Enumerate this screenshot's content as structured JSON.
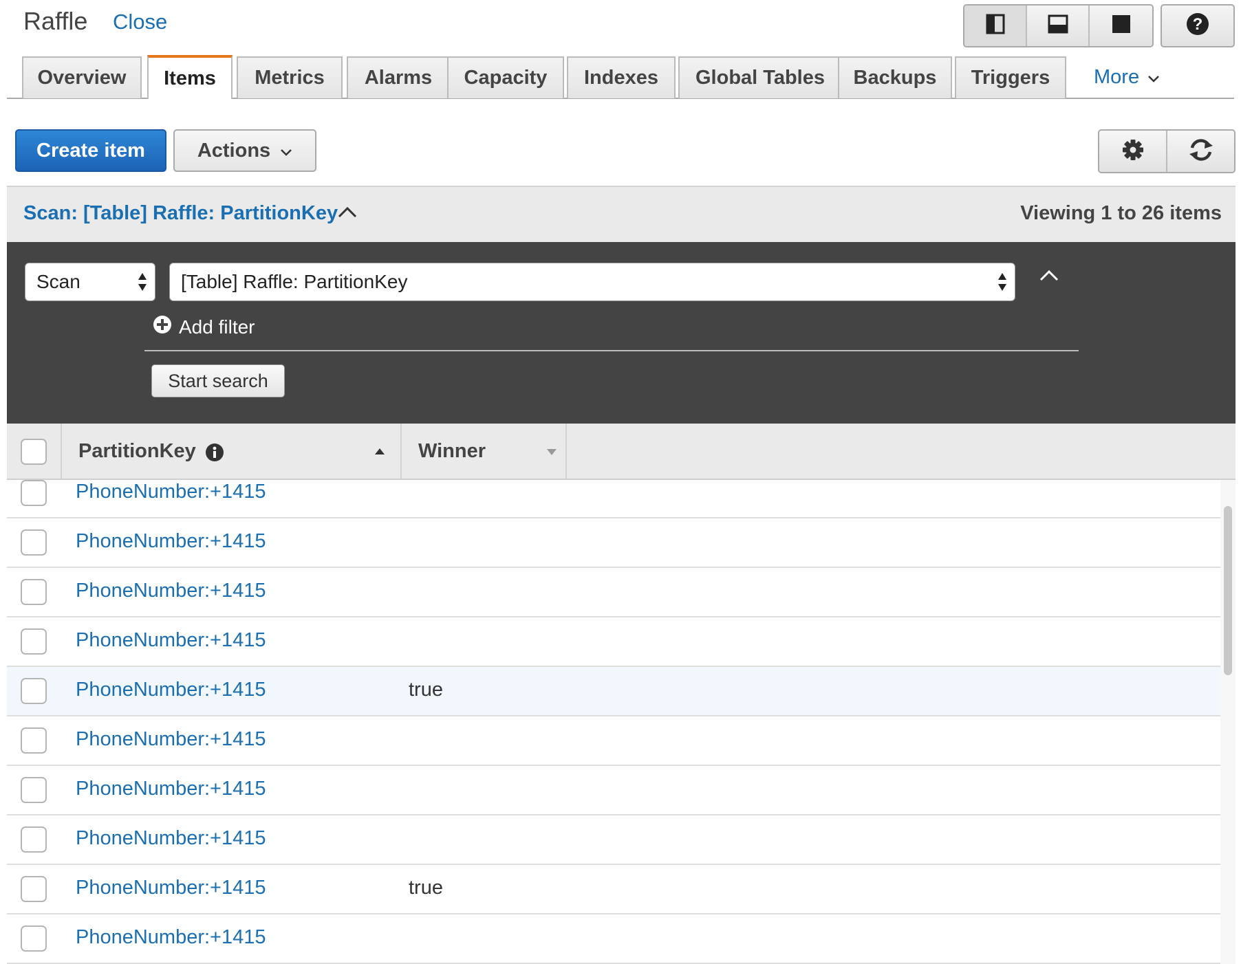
{
  "header": {
    "title": "Raffle",
    "close_label": "Close",
    "view_buttons": [
      "split-vertical-icon",
      "split-horizontal-icon",
      "fullscreen-icon"
    ],
    "help_icon": "help-icon"
  },
  "tabs": [
    {
      "label": "Overview",
      "active": false
    },
    {
      "label": "Items",
      "active": true
    },
    {
      "label": "Metrics",
      "active": false
    },
    {
      "label": "Alarms",
      "active": false
    },
    {
      "label": "Capacity",
      "active": false
    },
    {
      "label": "Indexes",
      "active": false
    },
    {
      "label": "Global Tables",
      "active": false
    },
    {
      "label": "Backups",
      "active": false
    },
    {
      "label": "Triggers",
      "active": false
    }
  ],
  "more_label": "More",
  "toolbar": {
    "create_label": "Create item",
    "actions_label": "Actions",
    "settings_icon": "gear-icon",
    "refresh_icon": "refresh-icon"
  },
  "scan_summary": {
    "title": "Scan: [Table] Raffle: PartitionKey",
    "viewing": "Viewing 1 to 26 items"
  },
  "query": {
    "operation": "Scan",
    "target": "[Table] Raffle: PartitionKey",
    "add_filter_label": "Add filter",
    "start_search_label": "Start search"
  },
  "table": {
    "columns": [
      "PartitionKey",
      "Winner"
    ],
    "rows": [
      {
        "partition_key": "PhoneNumber:+1415",
        "winner": ""
      },
      {
        "partition_key": "PhoneNumber:+1415",
        "winner": ""
      },
      {
        "partition_key": "PhoneNumber:+1415",
        "winner": ""
      },
      {
        "partition_key": "PhoneNumber:+1415",
        "winner": ""
      },
      {
        "partition_key": "PhoneNumber:+1415",
        "winner": "true"
      },
      {
        "partition_key": "PhoneNumber:+1415",
        "winner": ""
      },
      {
        "partition_key": "PhoneNumber:+1415",
        "winner": ""
      },
      {
        "partition_key": "PhoneNumber:+1415",
        "winner": ""
      },
      {
        "partition_key": "PhoneNumber:+1415",
        "winner": "true"
      },
      {
        "partition_key": "PhoneNumber:+1415",
        "winner": ""
      }
    ]
  },
  "colors": {
    "link": "#1a6fb3",
    "primary": "#1c63b5",
    "active_tab_accent": "#e4761b",
    "panel": "#444444"
  }
}
